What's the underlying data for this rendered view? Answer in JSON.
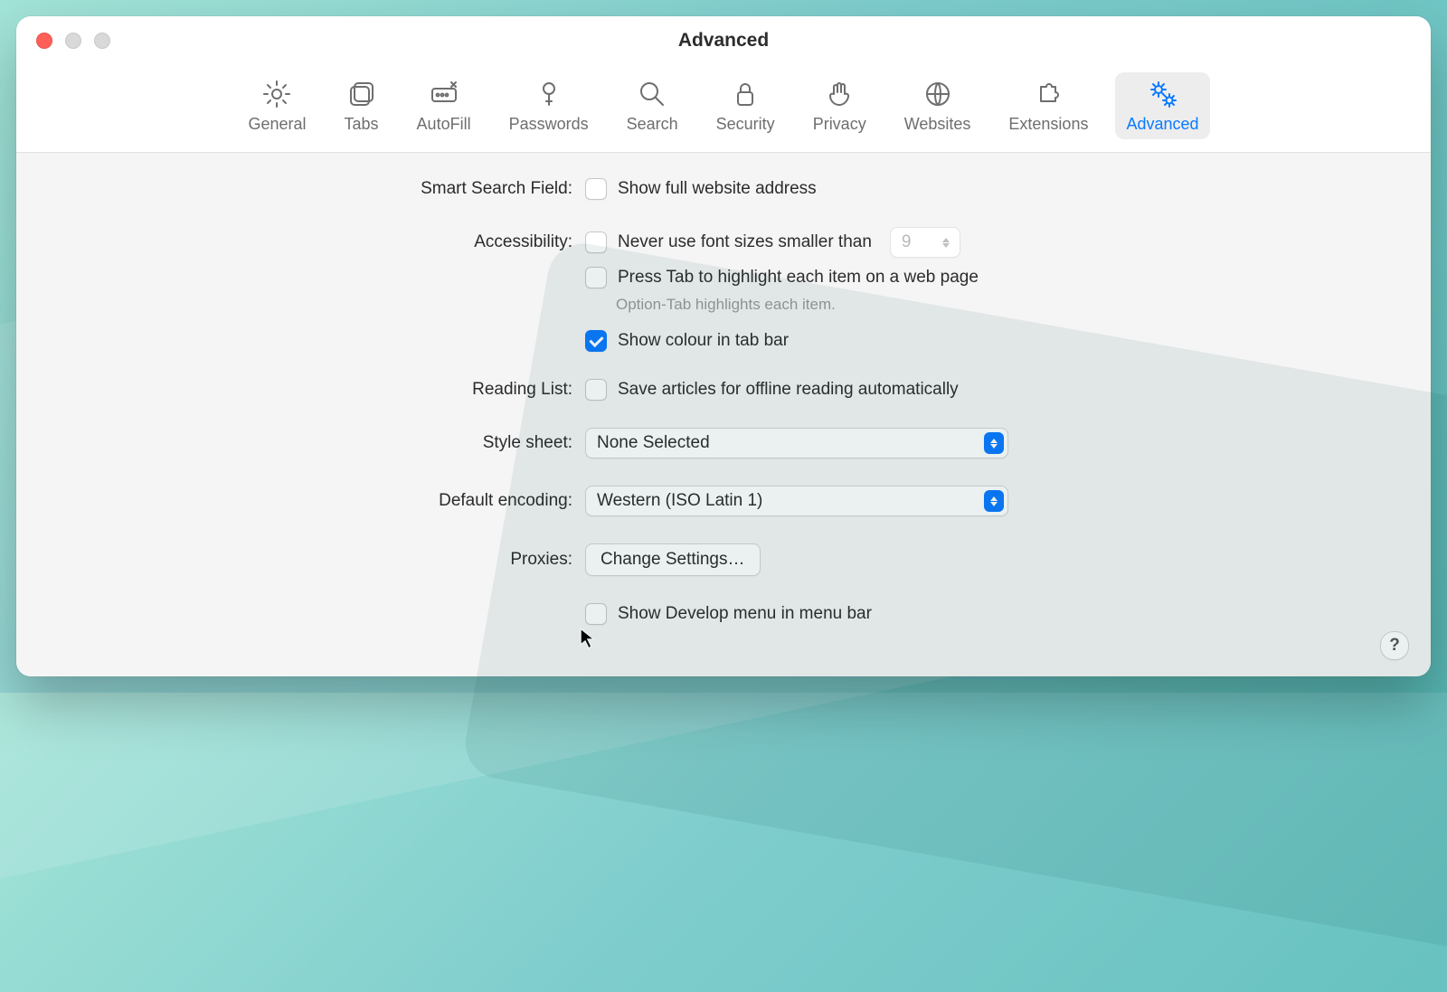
{
  "window": {
    "title": "Advanced"
  },
  "tabs": {
    "general": "General",
    "tabs": "Tabs",
    "autofill": "AutoFill",
    "passwords": "Passwords",
    "search": "Search",
    "security": "Security",
    "privacy": "Privacy",
    "websites": "Websites",
    "extensions": "Extensions",
    "advanced": "Advanced"
  },
  "labels": {
    "smartSearch": "Smart Search Field:",
    "accessibility": "Accessibility:",
    "readingList": "Reading List:",
    "styleSheet": "Style sheet:",
    "defaultEncoding": "Default encoding:",
    "proxies": "Proxies:"
  },
  "options": {
    "showFullAddress": "Show full website address",
    "neverFontSmaller": "Never use font sizes smaller than",
    "fontSizeValue": "9",
    "pressTab": "Press Tab to highlight each item on a web page",
    "optionTabHint": "Option-Tab highlights each item.",
    "showColourTab": "Show colour in tab bar",
    "saveOffline": "Save articles for offline reading automatically",
    "showDevelop": "Show Develop menu in menu bar"
  },
  "selects": {
    "styleSheet": "None Selected",
    "defaultEncoding": "Western (ISO Latin 1)"
  },
  "buttons": {
    "changeSettings": "Change Settings…",
    "help": "?"
  },
  "checked": {
    "showFullAddress": false,
    "neverFontSmaller": false,
    "pressTab": false,
    "showColourTab": true,
    "saveOffline": false,
    "showDevelop": false
  }
}
